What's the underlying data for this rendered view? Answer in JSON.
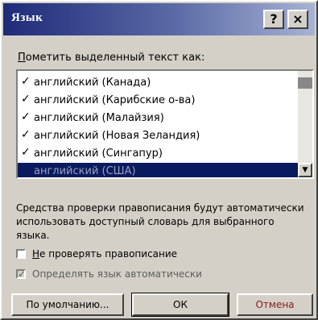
{
  "window": {
    "title": "Язык",
    "help_label": "?",
    "close_label": "×"
  },
  "prompt": {
    "first_letter": "П",
    "rest": "ометить выделенный текст как:"
  },
  "languages": {
    "items": [
      {
        "label": "английский (Канада)",
        "checked": true,
        "selected": false
      },
      {
        "label": "английский (Карибские о-ва)",
        "checked": true,
        "selected": false
      },
      {
        "label": "английский (Малайзия)",
        "checked": true,
        "selected": false
      },
      {
        "label": "английский (Новая Зеландия)",
        "checked": true,
        "selected": false
      },
      {
        "label": "английский (Сингапур)",
        "checked": true,
        "selected": false
      },
      {
        "label": "английский (США)",
        "checked": true,
        "selected": true
      }
    ],
    "check_glyph": "✓"
  },
  "description": "Средства проверки правописания будут автоматически использовать доступный словарь для выбранного языка.",
  "options": {
    "no_proofing": {
      "label_first": "Н",
      "label_rest": "е проверять правописание",
      "checked": false
    },
    "detect_language": {
      "label": "Определять язык автоматически",
      "checked": true,
      "check_glyph": "✓"
    }
  },
  "buttons": {
    "default_label": "По умолчанию...",
    "ok_label": "ОК",
    "cancel_label": "Отмена"
  }
}
